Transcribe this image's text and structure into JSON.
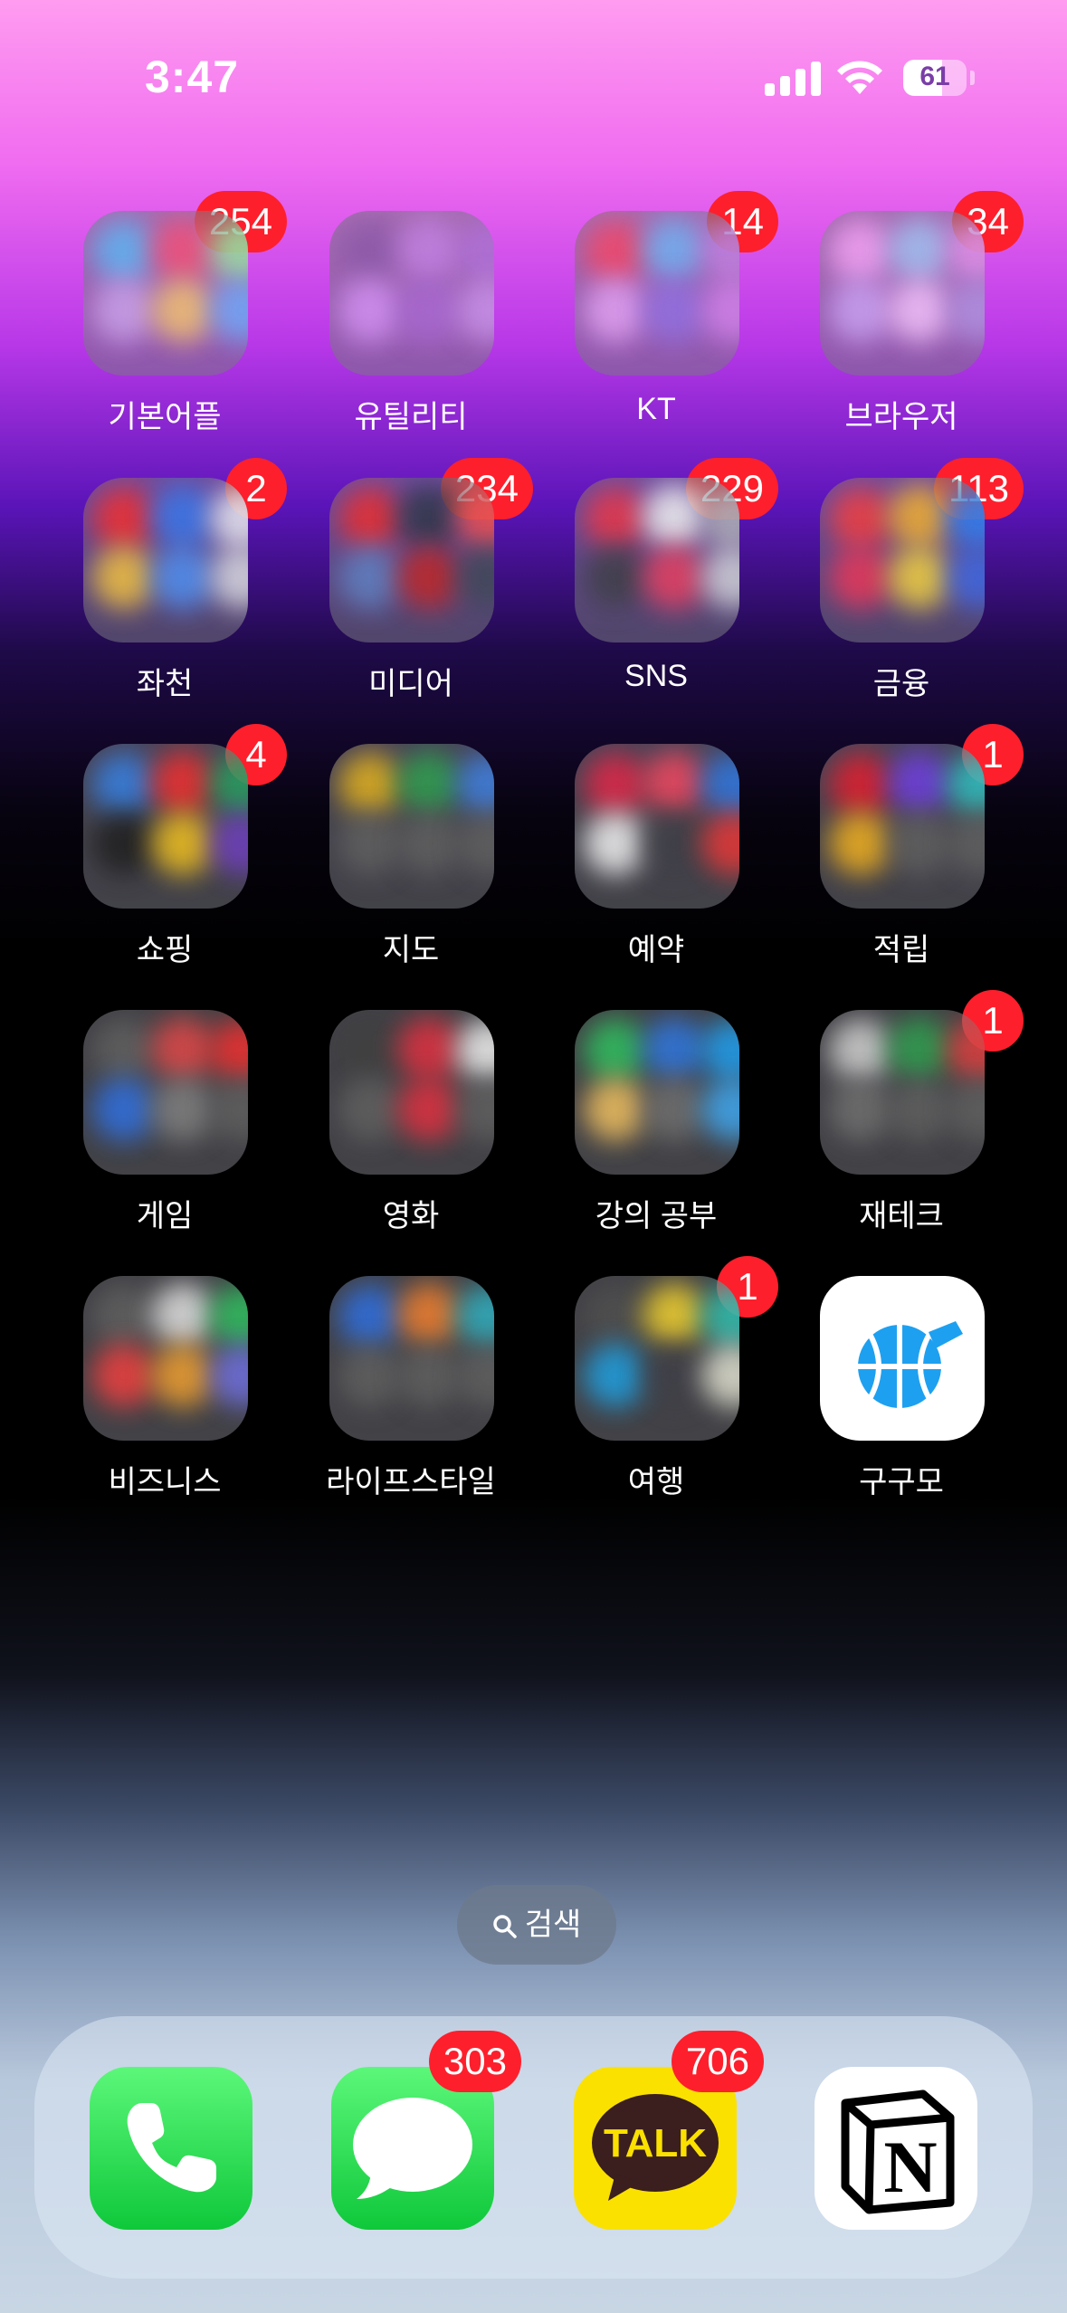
{
  "status_bar": {
    "time": "3:47",
    "battery": "61",
    "battery_level": 0.61
  },
  "apps": [
    {
      "label": "기본어플",
      "badge": "254",
      "kind": "folder",
      "colors": [
        "#5db2f0",
        "#f05078",
        "#9be0a0",
        "#c8a0e8",
        "#f0c070",
        "#70a8f8"
      ]
    },
    {
      "label": "유틸리티",
      "badge": "",
      "kind": "folder",
      "colors": [
        "#8c5aa8",
        "#c080e0",
        "#b070d8",
        "#d090f0",
        "#a868d0",
        "#c890e8"
      ]
    },
    {
      "label": "KT",
      "badge": "14",
      "kind": "folder",
      "colors": [
        "#f04868",
        "#70b0f0",
        "#c080e0",
        "#e0a0f0",
        "#9070e0",
        "#d080e8"
      ]
    },
    {
      "label": "브라우저",
      "badge": "34",
      "kind": "folder",
      "colors": [
        "#f0a0f0",
        "#a0c0f0",
        "#e090e8",
        "#c8a0f0",
        "#f0c0f8",
        "#b090e0"
      ]
    },
    {
      "label": "좌천",
      "badge": "2",
      "kind": "folder",
      "colors": [
        "#f03030",
        "#3a78e8",
        "#e8e8f0",
        "#f0c040",
        "#5090f0",
        "#d8d8e0"
      ]
    },
    {
      "label": "미디어",
      "badge": "234",
      "kind": "folder",
      "colors": [
        "#e83030",
        "#303848",
        "#f05050",
        "#6080c0",
        "#c02828",
        "#404858"
      ]
    },
    {
      "label": "SNS",
      "badge": "229",
      "kind": "folder",
      "colors": [
        "#e83848",
        "#f0f0f0",
        "#b0b0b8",
        "#404048",
        "#e84060",
        "#d0d0d8"
      ]
    },
    {
      "label": "금융",
      "badge": "113",
      "kind": "folder",
      "colors": [
        "#f04040",
        "#f0b030",
        "#3080f0",
        "#e83858",
        "#f0d040",
        "#4068e0"
      ]
    },
    {
      "label": "쇼핑",
      "badge": "4",
      "kind": "folder",
      "colors": [
        "#3880e0",
        "#f03030",
        "#28a060",
        "#202020",
        "#f0c020",
        "#7040c0"
      ]
    },
    {
      "label": "지도",
      "badge": "",
      "kind": "folder",
      "colors": [
        "#e0b020",
        "#30a050",
        "#4080e0",
        "#606060",
        "#606060",
        "#606060"
      ]
    },
    {
      "label": "예약",
      "badge": "",
      "kind": "folder",
      "colors": [
        "#e02848",
        "#f04860",
        "#3078e0",
        "#f0f0f0",
        "#404048",
        "#e83838"
      ]
    },
    {
      "label": "적립",
      "badge": "1",
      "kind": "folder",
      "colors": [
        "#e02030",
        "#7040e0",
        "#30c0c0",
        "#f0b020",
        "#606060",
        "#606060"
      ]
    },
    {
      "label": "게임",
      "badge": "",
      "kind": "folder",
      "colors": [
        "#606060",
        "#e04848",
        "#f03030",
        "#3070e0",
        "#808080",
        "#606060"
      ]
    },
    {
      "label": "영화",
      "badge": "",
      "kind": "folder",
      "colors": [
        "#404040",
        "#e03040",
        "#f0f0f0",
        "#606060",
        "#e03040",
        "#606060"
      ]
    },
    {
      "label": "강의 공부",
      "badge": "",
      "kind": "folder",
      "colors": [
        "#30c060",
        "#3078e0",
        "#20a0f0",
        "#f0c060",
        "#707070",
        "#40a8f0"
      ]
    },
    {
      "label": "재테크",
      "badge": "1",
      "kind": "folder",
      "colors": [
        "#d0d0d0",
        "#30a050",
        "#e04040",
        "#707070",
        "#606060",
        "#606060"
      ]
    },
    {
      "label": "비즈니스",
      "badge": "",
      "kind": "folder",
      "colors": [
        "#606060",
        "#e0e0e0",
        "#30c060",
        "#f04040",
        "#f0a030",
        "#7070e0"
      ]
    },
    {
      "label": "라이프스타일",
      "badge": "",
      "kind": "folder",
      "colors": [
        "#3070e0",
        "#f08030",
        "#30b0c0",
        "#606060",
        "#606060",
        "#606060"
      ]
    },
    {
      "label": "여행",
      "badge": "1",
      "kind": "folder",
      "colors": [
        "#505050",
        "#f0d030",
        "#30c0b0",
        "#20a0e0",
        "#404048",
        "#e0e0d0"
      ]
    },
    {
      "label": "구구모",
      "badge": "",
      "kind": "app",
      "colors": [
        "#1ea0f0"
      ]
    }
  ],
  "search": {
    "label": "검색"
  },
  "dock": [
    {
      "name": "phone",
      "badge": ""
    },
    {
      "name": "messages",
      "badge": "303"
    },
    {
      "name": "kakaotalk",
      "badge": "706",
      "text": "TALK"
    },
    {
      "name": "notion",
      "badge": ""
    }
  ]
}
